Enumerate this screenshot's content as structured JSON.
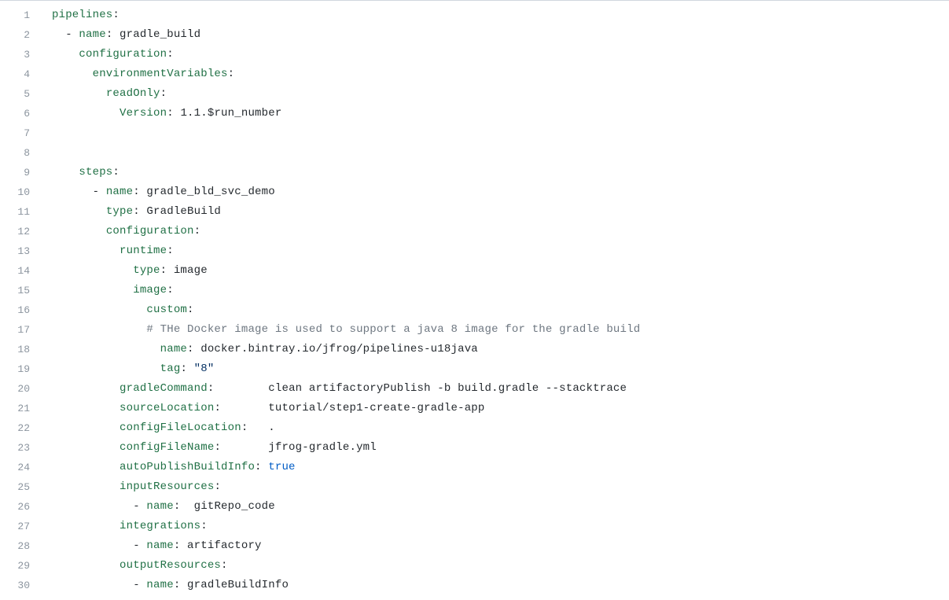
{
  "colors": {
    "key": "#207045",
    "value": "#24292e",
    "string": "#032f62",
    "bool": "#005cc5",
    "comment": "#6e7781",
    "gutter": "#8c959f",
    "border": "#d0d7de"
  },
  "lines": {
    "l1": {
      "n": "1",
      "indent": "",
      "tokens": [
        {
          "t": "pipelines",
          "c": "key"
        },
        {
          "t": ":",
          "c": "punct"
        }
      ]
    },
    "l2": {
      "n": "2",
      "indent": "  ",
      "tokens": [
        {
          "t": "- ",
          "c": "dash"
        },
        {
          "t": "name",
          "c": "key"
        },
        {
          "t": ": ",
          "c": "punct"
        },
        {
          "t": "gradle_build",
          "c": "value"
        }
      ]
    },
    "l3": {
      "n": "3",
      "indent": "    ",
      "tokens": [
        {
          "t": "configuration",
          "c": "key"
        },
        {
          "t": ":",
          "c": "punct"
        }
      ]
    },
    "l4": {
      "n": "4",
      "indent": "      ",
      "tokens": [
        {
          "t": "environmentVariables",
          "c": "key"
        },
        {
          "t": ":",
          "c": "punct"
        }
      ]
    },
    "l5": {
      "n": "5",
      "indent": "        ",
      "tokens": [
        {
          "t": "readOnly",
          "c": "key"
        },
        {
          "t": ":",
          "c": "punct"
        }
      ]
    },
    "l6": {
      "n": "6",
      "indent": "          ",
      "tokens": [
        {
          "t": "Version",
          "c": "key"
        },
        {
          "t": ": ",
          "c": "punct"
        },
        {
          "t": "1.1.$run_number",
          "c": "value"
        }
      ]
    },
    "l7": {
      "n": "7",
      "indent": "",
      "tokens": []
    },
    "l8": {
      "n": "8",
      "indent": "",
      "tokens": []
    },
    "l9": {
      "n": "9",
      "indent": "    ",
      "tokens": [
        {
          "t": "steps",
          "c": "key"
        },
        {
          "t": ":",
          "c": "punct"
        }
      ]
    },
    "l10": {
      "n": "10",
      "indent": "      ",
      "tokens": [
        {
          "t": "- ",
          "c": "dash"
        },
        {
          "t": "name",
          "c": "key"
        },
        {
          "t": ": ",
          "c": "punct"
        },
        {
          "t": "gradle_bld_svc_demo",
          "c": "value"
        }
      ]
    },
    "l11": {
      "n": "11",
      "indent": "        ",
      "tokens": [
        {
          "t": "type",
          "c": "key"
        },
        {
          "t": ": ",
          "c": "punct"
        },
        {
          "t": "GradleBuild",
          "c": "value"
        }
      ]
    },
    "l12": {
      "n": "12",
      "indent": "        ",
      "tokens": [
        {
          "t": "configuration",
          "c": "key"
        },
        {
          "t": ":",
          "c": "punct"
        }
      ]
    },
    "l13": {
      "n": "13",
      "indent": "          ",
      "tokens": [
        {
          "t": "runtime",
          "c": "key"
        },
        {
          "t": ":",
          "c": "punct"
        }
      ]
    },
    "l14": {
      "n": "14",
      "indent": "            ",
      "tokens": [
        {
          "t": "type",
          "c": "key"
        },
        {
          "t": ": ",
          "c": "punct"
        },
        {
          "t": "image",
          "c": "value"
        }
      ]
    },
    "l15": {
      "n": "15",
      "indent": "            ",
      "tokens": [
        {
          "t": "image",
          "c": "key"
        },
        {
          "t": ":",
          "c": "punct"
        }
      ]
    },
    "l16": {
      "n": "16",
      "indent": "              ",
      "tokens": [
        {
          "t": "custom",
          "c": "key"
        },
        {
          "t": ":",
          "c": "punct"
        }
      ]
    },
    "l17": {
      "n": "17",
      "indent": "              ",
      "tokens": [
        {
          "t": "# THe Docker image is used to support a java 8 image for the gradle build",
          "c": "comment"
        }
      ]
    },
    "l18": {
      "n": "18",
      "indent": "                ",
      "tokens": [
        {
          "t": "name",
          "c": "key"
        },
        {
          "t": ": ",
          "c": "punct"
        },
        {
          "t": "docker.bintray.io/jfrog/pipelines-u18java",
          "c": "value"
        }
      ]
    },
    "l19": {
      "n": "19",
      "indent": "                ",
      "tokens": [
        {
          "t": "tag",
          "c": "key"
        },
        {
          "t": ": ",
          "c": "punct"
        },
        {
          "t": "\"8\"",
          "c": "str"
        }
      ]
    },
    "l20": {
      "n": "20",
      "indent": "          ",
      "tokens": [
        {
          "t": "gradleCommand",
          "c": "key"
        },
        {
          "t": ":        ",
          "c": "punct"
        },
        {
          "t": "clean artifactoryPublish -b build.gradle --stacktrace",
          "c": "value"
        }
      ]
    },
    "l21": {
      "n": "21",
      "indent": "          ",
      "tokens": [
        {
          "t": "sourceLocation",
          "c": "key"
        },
        {
          "t": ":       ",
          "c": "punct"
        },
        {
          "t": "tutorial/step1-create-gradle-app",
          "c": "value"
        }
      ]
    },
    "l22": {
      "n": "22",
      "indent": "          ",
      "tokens": [
        {
          "t": "configFileLocation",
          "c": "key"
        },
        {
          "t": ":   ",
          "c": "punct"
        },
        {
          "t": ".",
          "c": "value"
        }
      ]
    },
    "l23": {
      "n": "23",
      "indent": "          ",
      "tokens": [
        {
          "t": "configFileName",
          "c": "key"
        },
        {
          "t": ":       ",
          "c": "punct"
        },
        {
          "t": "jfrog-gradle.yml",
          "c": "value"
        }
      ]
    },
    "l24": {
      "n": "24",
      "indent": "          ",
      "tokens": [
        {
          "t": "autoPublishBuildInfo",
          "c": "key"
        },
        {
          "t": ": ",
          "c": "punct"
        },
        {
          "t": "true",
          "c": "bool"
        }
      ]
    },
    "l25": {
      "n": "25",
      "indent": "          ",
      "tokens": [
        {
          "t": "inputResources",
          "c": "key"
        },
        {
          "t": ":",
          "c": "punct"
        }
      ]
    },
    "l26": {
      "n": "26",
      "indent": "            ",
      "tokens": [
        {
          "t": "- ",
          "c": "dash"
        },
        {
          "t": "name",
          "c": "key"
        },
        {
          "t": ":  ",
          "c": "punct"
        },
        {
          "t": "gitRepo_code",
          "c": "value"
        }
      ]
    },
    "l27": {
      "n": "27",
      "indent": "          ",
      "tokens": [
        {
          "t": "integrations",
          "c": "key"
        },
        {
          "t": ":",
          "c": "punct"
        }
      ]
    },
    "l28": {
      "n": "28",
      "indent": "            ",
      "tokens": [
        {
          "t": "- ",
          "c": "dash"
        },
        {
          "t": "name",
          "c": "key"
        },
        {
          "t": ": ",
          "c": "punct"
        },
        {
          "t": "artifactory",
          "c": "value"
        }
      ]
    },
    "l29": {
      "n": "29",
      "indent": "          ",
      "tokens": [
        {
          "t": "outputResources",
          "c": "key"
        },
        {
          "t": ":",
          "c": "punct"
        }
      ]
    },
    "l30": {
      "n": "30",
      "indent": "            ",
      "tokens": [
        {
          "t": "- ",
          "c": "dash"
        },
        {
          "t": "name",
          "c": "key"
        },
        {
          "t": ": ",
          "c": "punct"
        },
        {
          "t": "gradleBuildInfo",
          "c": "value"
        }
      ]
    }
  },
  "order": [
    "l1",
    "l2",
    "l3",
    "l4",
    "l5",
    "l6",
    "l7",
    "l8",
    "l9",
    "l10",
    "l11",
    "l12",
    "l13",
    "l14",
    "l15",
    "l16",
    "l17",
    "l18",
    "l19",
    "l20",
    "l21",
    "l22",
    "l23",
    "l24",
    "l25",
    "l26",
    "l27",
    "l28",
    "l29",
    "l30"
  ]
}
